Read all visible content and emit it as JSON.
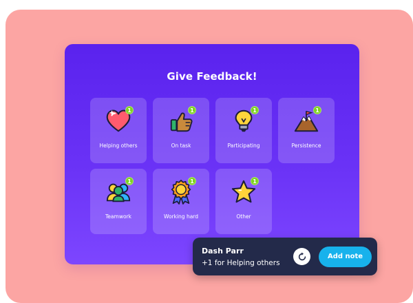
{
  "panel": {
    "title": "Give Feedback!"
  },
  "tiles": [
    {
      "label": "Helping others",
      "icon": "heart-icon",
      "count": "1"
    },
    {
      "label": "On task",
      "icon": "thumbs-up-icon",
      "count": "1"
    },
    {
      "label": "Participating",
      "icon": "lightbulb-icon",
      "count": "1"
    },
    {
      "label": "Persistence",
      "icon": "mountain-flag-icon",
      "count": "1"
    },
    {
      "label": "Teamwork",
      "icon": "teamwork-icon",
      "count": "1"
    },
    {
      "label": "Working hard",
      "icon": "medal-icon",
      "count": "1"
    },
    {
      "label": "Other",
      "icon": "star-icon",
      "count": "1"
    }
  ],
  "toast": {
    "name": "Dash Parr",
    "message": "+1 for Helping others",
    "undo_icon": "undo-icon",
    "add_note_label": "Add note"
  },
  "colors": {
    "background": "#fca5a3",
    "panel_top": "#5a22ee",
    "panel_bottom": "#7d46ff",
    "badge": "#7ed321",
    "toast_bg": "#232a4a",
    "button": "#17b2ec"
  }
}
